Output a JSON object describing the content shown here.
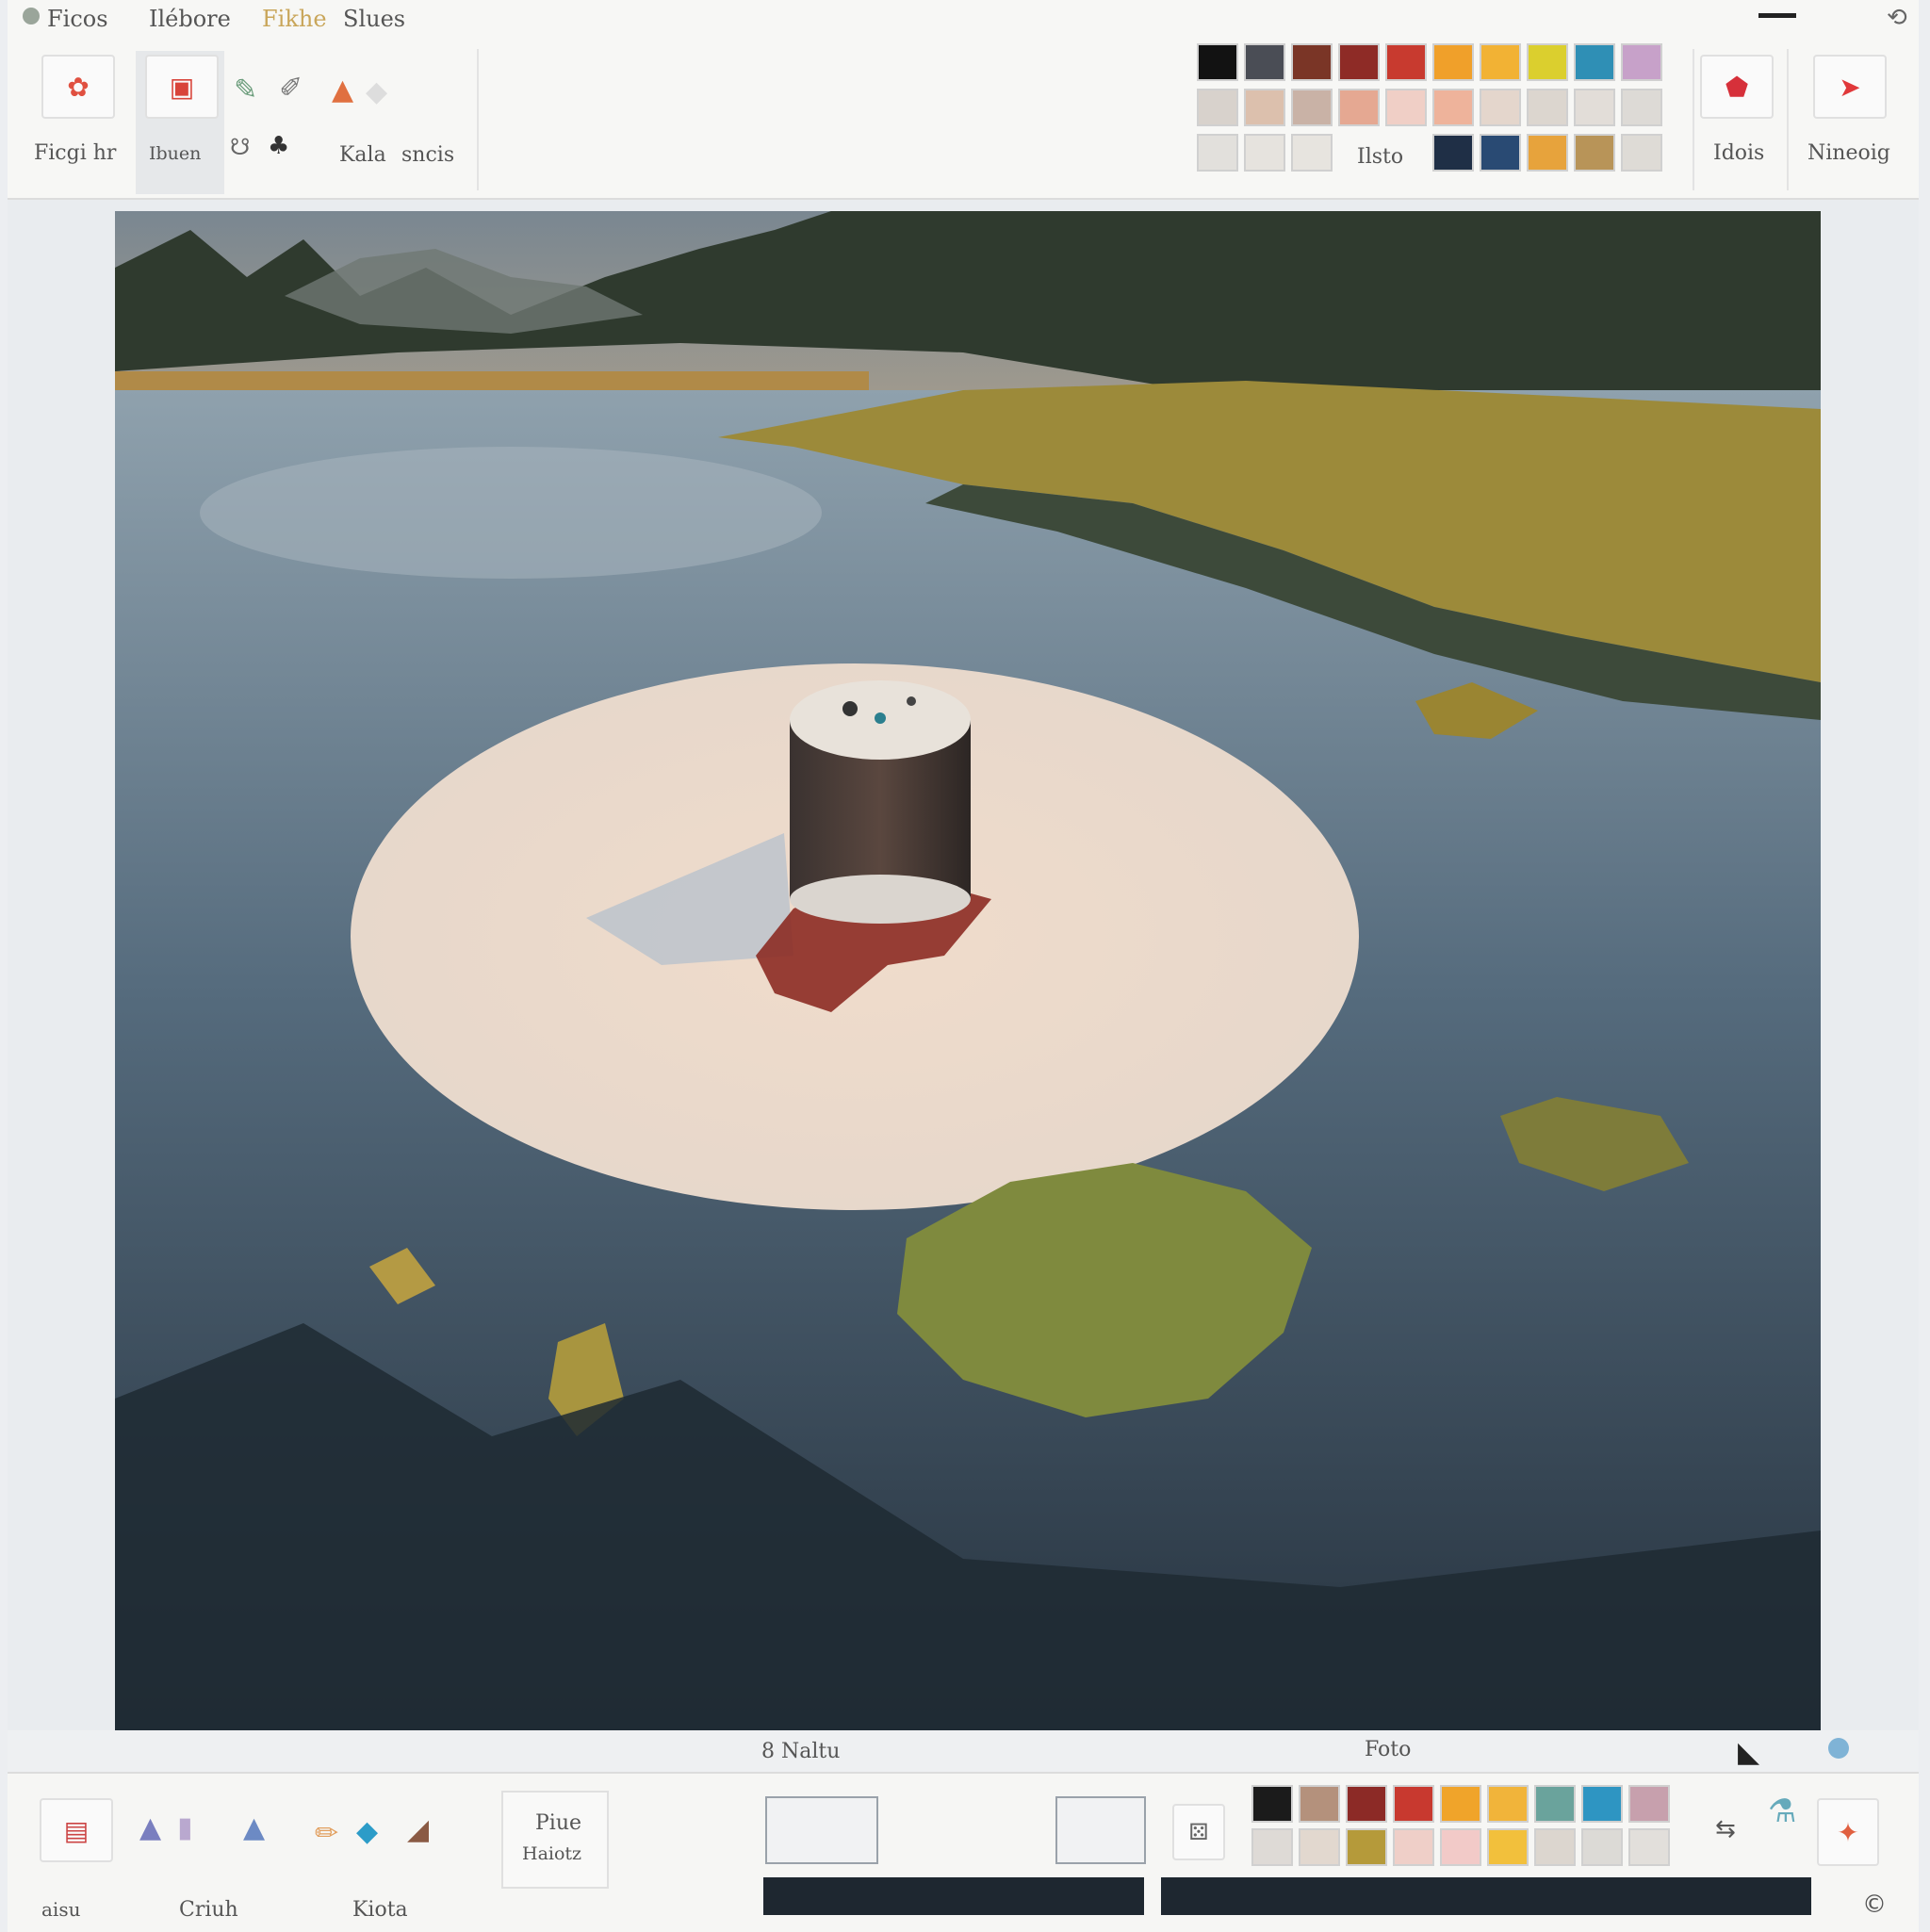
{
  "menu": [
    "Ficos",
    "Ilébore",
    "Fikhe",
    "Slues"
  ],
  "ribbon": {
    "labels": [
      "Ficgi hr",
      "Ibuen",
      "Kala",
      "sncis"
    ],
    "palette_title": "Ilsto",
    "right_buttons": [
      "Idois",
      "Nineoig"
    ]
  },
  "palette_top": [
    "#121212",
    "#4a4d55",
    "#7a3526",
    "#8e2b26",
    "#c83a2f",
    "#f0a02a",
    "#f2b234",
    "#dbcf2e",
    "#2f8fb5",
    "#c7a1c9",
    "#d8d2cc",
    "#dcc0ad",
    "#c9b2a6",
    "#e5a892",
    "#f0cfc6",
    "#eeb39b",
    "#e4d6cc",
    "#dcd6cf",
    "#e2ddd8",
    "#dddad6",
    "#e2e0dc",
    "#e6e3de",
    "#e7e4df"
  ],
  "palette_top_row3_tail": [
    "#1f2f46",
    "#294a73",
    "#e7a33c",
    "#b89458",
    "#dedbd6"
  ],
  "status": {
    "left": "8 Naltu",
    "right": "Foto"
  },
  "bottom": {
    "labels": [
      "aisu",
      "Criuh",
      "Kiota",
      "Piue",
      "Haiotz"
    ],
    "palette": [
      "#1b1b1b",
      "#b4917c",
      "#8c2a26",
      "#c8392f",
      "#f0a42a",
      "#f1b43a",
      "#6aa39c",
      "#2e95c2",
      "#c7a0ad",
      "#dedad6",
      "#e2d8cf",
      "#b59a3a",
      "#efcfc8",
      "#f2cac8",
      "#f2c03c",
      "#dcd6cf",
      "#dcdad6",
      "#e2dfdb"
    ]
  }
}
